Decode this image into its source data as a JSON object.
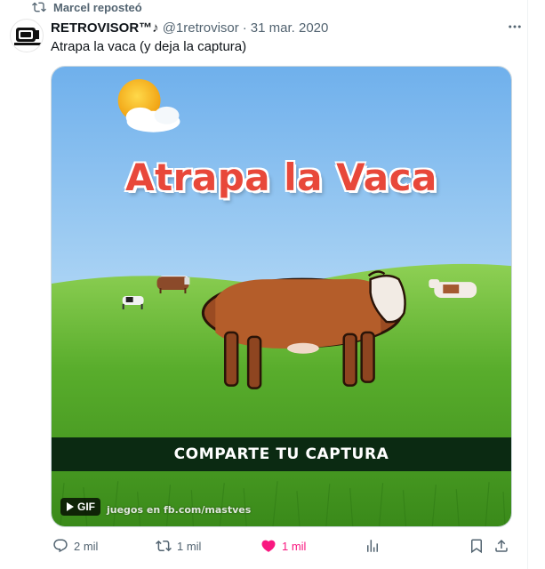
{
  "repost": {
    "label": "Marcel reposteó"
  },
  "tweet": {
    "display_name": "RETROVISOR™♪",
    "handle": "@1retrovisor",
    "separator": "·",
    "date": "31 mar. 2020",
    "text": "Atrapa la vaca (y deja la captura)"
  },
  "media": {
    "title": "Atrapa la Vaca",
    "banner": "COMPARTE TU CAPTURA",
    "gif_label": "GIF",
    "watermark": "juegos en fb.com/mastves"
  },
  "actions": {
    "replies": "2 mil",
    "reposts": "1 mil",
    "likes": "1 mil"
  },
  "icons": {
    "repost": "repost-icon",
    "more": "more-icon",
    "reply": "reply-icon",
    "like": "heart-icon",
    "views": "views-icon",
    "bookmark": "bookmark-icon",
    "share": "share-icon"
  },
  "colors": {
    "like_active": "#f91880",
    "secondary_text": "#536471",
    "title_red": "#e8483a",
    "banner_bg": "#0b2a12"
  }
}
